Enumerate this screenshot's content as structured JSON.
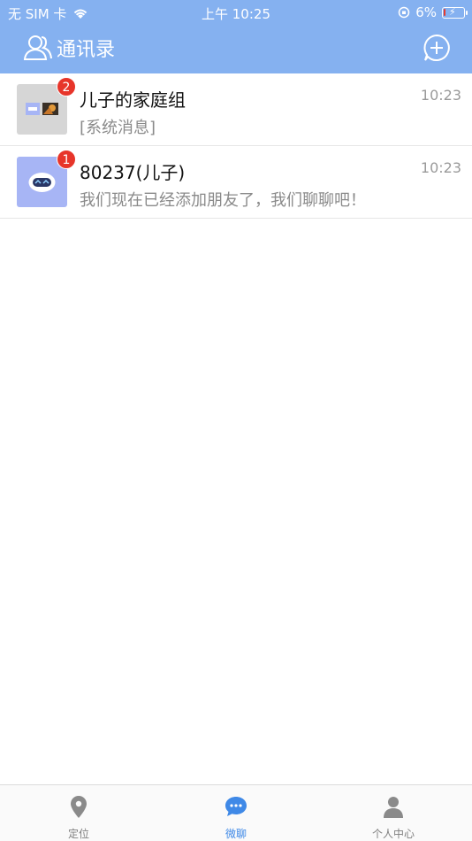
{
  "status_bar": {
    "carrier": "无 SIM 卡",
    "time": "上午 10:25",
    "battery": "6%"
  },
  "nav": {
    "title": "通讯录"
  },
  "conversations": [
    {
      "name": "儿子的家庭组",
      "preview": "[系统消息]",
      "time": "10:23",
      "unread": "2"
    },
    {
      "name": "80237(儿子)",
      "preview": "我们现在已经添加朋友了，我们聊聊吧！",
      "time": "10:23",
      "unread": "1"
    }
  ],
  "tabs": [
    {
      "label": "定位",
      "icon": "location-pin-icon",
      "active": false
    },
    {
      "label": "微聊",
      "icon": "chat-bubble-icon",
      "active": true
    },
    {
      "label": "个人中心",
      "icon": "person-icon",
      "active": false
    }
  ],
  "colors": {
    "header": "#85b1f0",
    "badge": "#e7352a",
    "active_tab": "#3f89e7"
  }
}
